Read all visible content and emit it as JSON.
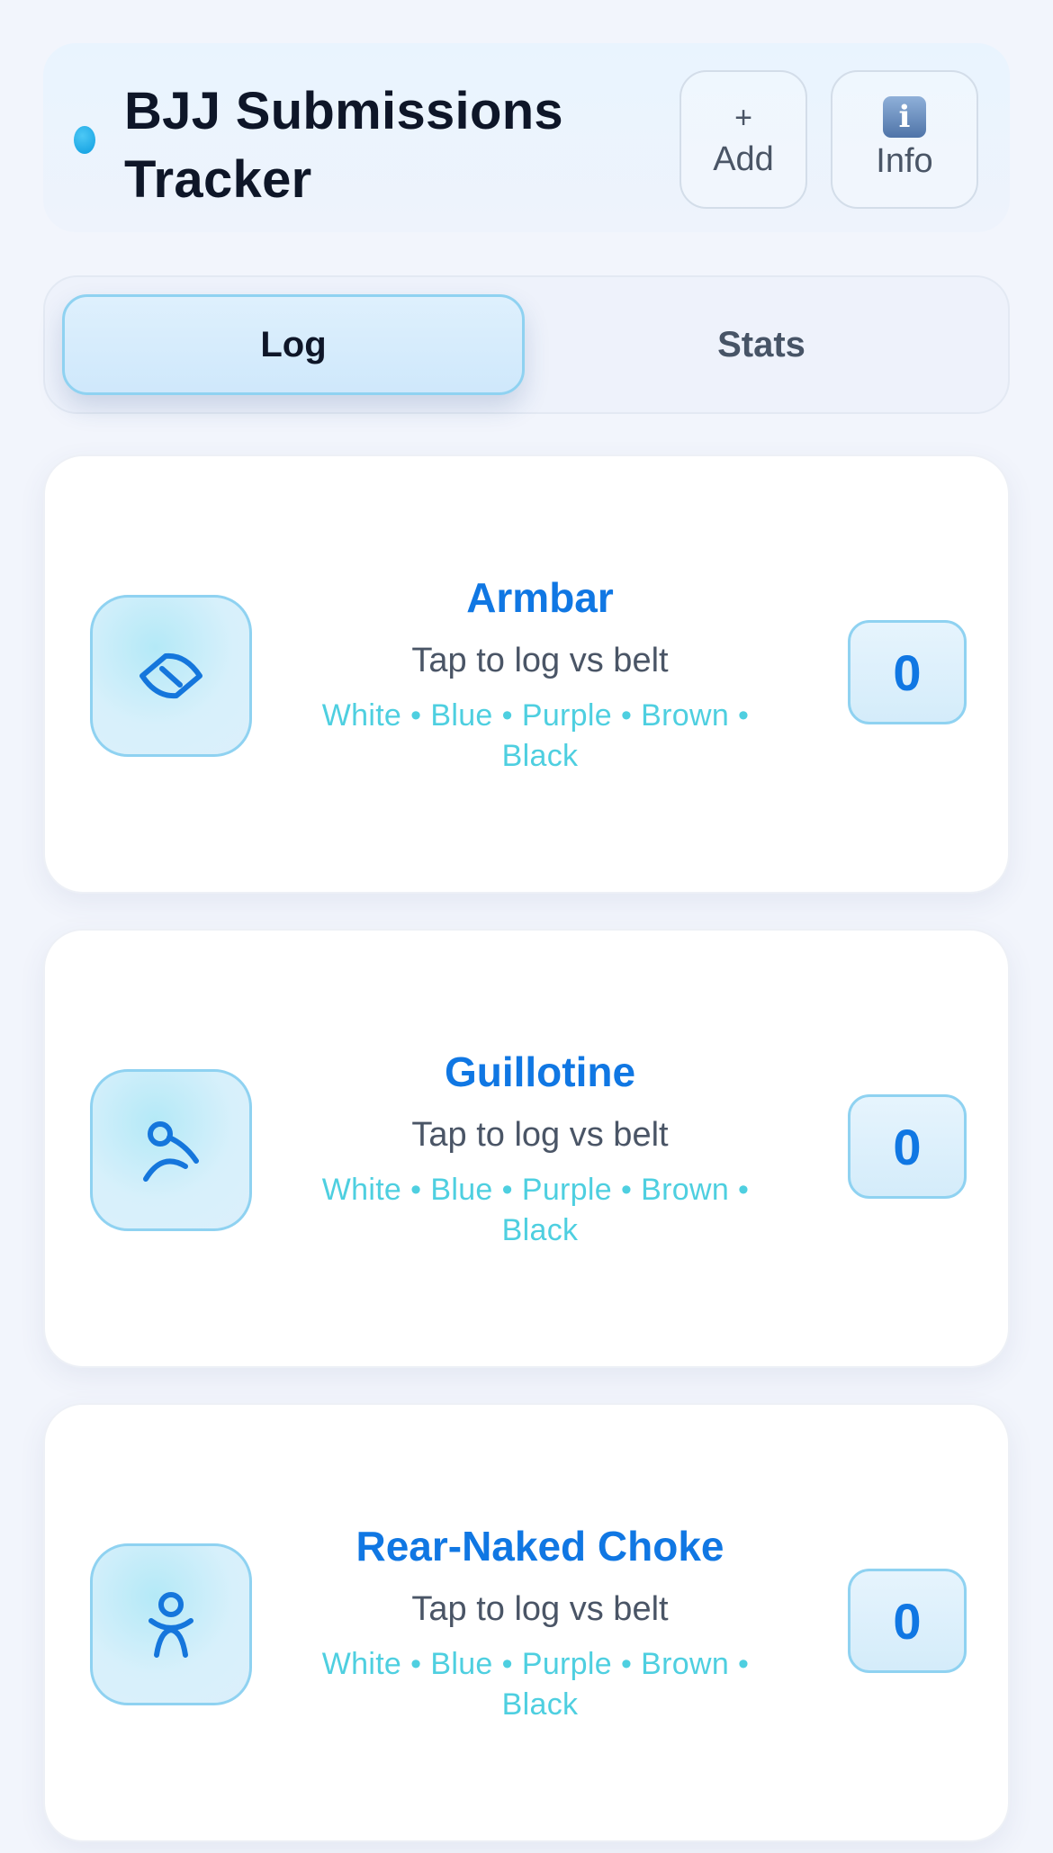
{
  "header": {
    "title": "BJJ Submissions Tracker",
    "add_symbol": "+",
    "add_label": "Add",
    "info_symbol": "i",
    "info_label": "Info"
  },
  "tabs": [
    {
      "label": "Log",
      "active": true
    },
    {
      "label": "Stats",
      "active": false
    }
  ],
  "cards": [
    {
      "title": "Armbar",
      "subtitle": "Tap to log vs belt",
      "belts": [
        "White",
        "Blue",
        "Purple",
        "Brown",
        "Black"
      ],
      "count": "0",
      "icon": "armbar-icon"
    },
    {
      "title": "Guillotine",
      "subtitle": "Tap to log vs belt",
      "belts": [
        "White",
        "Blue",
        "Purple",
        "Brown",
        "Black"
      ],
      "count": "0",
      "icon": "guillotine-icon"
    },
    {
      "title": "Rear-Naked Choke",
      "subtitle": "Tap to log vs belt",
      "belts": [
        "White",
        "Blue",
        "Purple",
        "Brown",
        "Black"
      ],
      "count": "0",
      "icon": "rear-naked-choke-icon"
    }
  ],
  "colors": {
    "accent": "#1077e3",
    "belt_text": "#4ecfe0",
    "border": "#8fd2f1",
    "status_dot": "#0e9de0"
  }
}
